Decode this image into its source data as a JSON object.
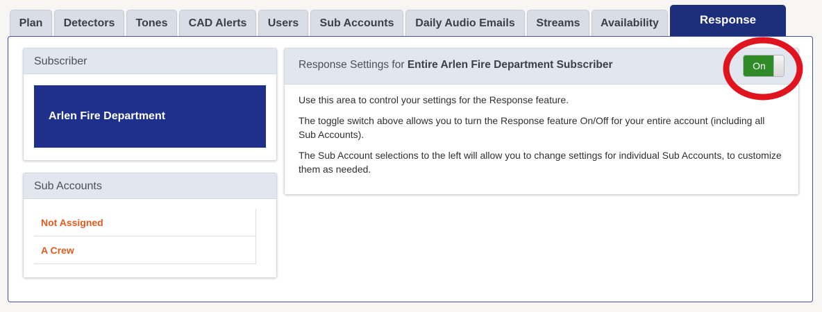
{
  "tabs": [
    {
      "label": "Plan"
    },
    {
      "label": "Detectors"
    },
    {
      "label": "Tones"
    },
    {
      "label": "CAD Alerts"
    },
    {
      "label": "Users"
    },
    {
      "label": "Sub Accounts"
    },
    {
      "label": "Daily Audio Emails"
    },
    {
      "label": "Streams"
    },
    {
      "label": "Availability"
    },
    {
      "label": "Response"
    }
  ],
  "active_tab": "Response",
  "subscriber": {
    "heading": "Subscriber",
    "name": "Arlen Fire Department"
  },
  "sub_accounts": {
    "heading": "Sub Accounts",
    "items": [
      {
        "label": "Not Assigned"
      },
      {
        "label": "A Crew"
      }
    ]
  },
  "response": {
    "heading_prefix": "Response Settings for ",
    "heading_bold": "Entire Arlen Fire Department Subscriber",
    "paragraphs": [
      "Use this area to control your settings for the Response feature.",
      "The toggle switch above allows you to turn the Response feature On/Off for your entire account (including all Sub Accounts).",
      "The Sub Account selections to the left will allow you to change settings for individual Sub Accounts, to customize them as needed."
    ],
    "toggle_label": "On"
  },
  "colors": {
    "brand": "#1f308c",
    "accent_link": "#e35a1c",
    "toggle_on": "#2e8b25",
    "highlight_ring": "#e0141e"
  }
}
